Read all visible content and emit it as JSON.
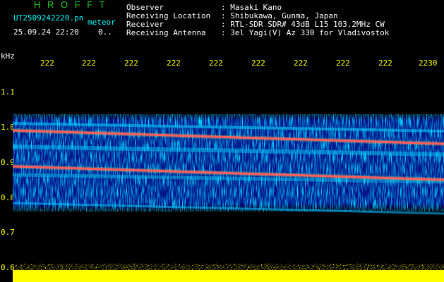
{
  "header": {
    "brand": "H R O F F T",
    "filename": "UT2509242220.pn",
    "filename_suffix": "meteor",
    "datetime": "25.09.24 22:20",
    "datetime_suffix": "0..",
    "rows": [
      {
        "label": "Observer",
        "value": ": Masaki Kano"
      },
      {
        "label": "Receiving Location",
        "value": ": Shibukawa, Gunma, Japan"
      },
      {
        "label": "Receiver",
        "value": ": RTL-SDR SDR# 43dB L15 103.2MHz CW"
      },
      {
        "label": "Receiving Antenna",
        "value": ": 3el Yagi(V) Az 330 for Vladivostok"
      }
    ]
  },
  "axes": {
    "y_unit": "kHz",
    "y_ticks": [
      "1.1",
      "1.0",
      "0.9",
      "0.8",
      "0.7",
      "0.6"
    ],
    "x_ticks": [
      "222",
      "222",
      "222",
      "222",
      "222",
      "222",
      "222",
      "222",
      "222",
      "2230"
    ]
  },
  "colors": {
    "background": "#000000",
    "noise_low": "#0000aa",
    "noise_mid": "#00c8ff",
    "noise_high": "#00ff66",
    "line": "#ff3355",
    "baseline": "#ffff00",
    "labels": "#ffffff",
    "ticks": "#ffff00",
    "brand": "#22cc22",
    "filename": "#00ffff"
  }
}
